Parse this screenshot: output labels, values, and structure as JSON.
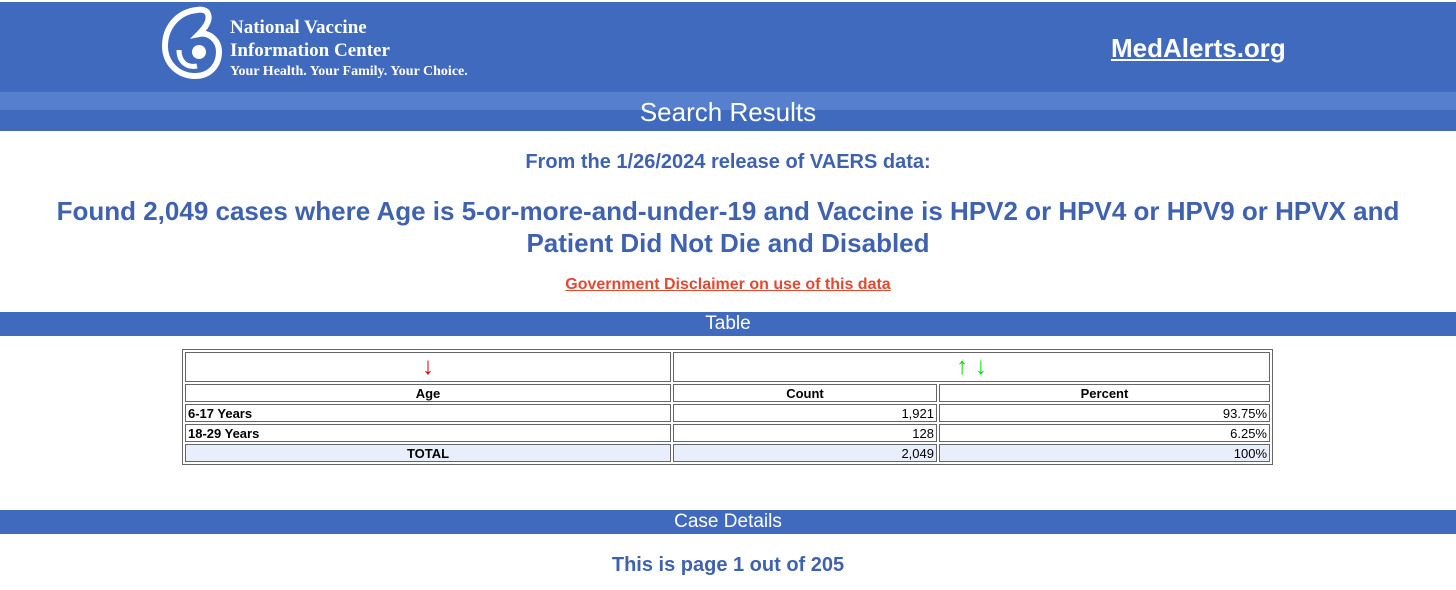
{
  "header": {
    "logo_line1": "National Vaccine",
    "logo_line2": "Information Center",
    "tagline": "Your Health. Your Family. Your Choice.",
    "site_link": "MedAlerts.org"
  },
  "results": {
    "title": "Search Results",
    "release": "From the 1/26/2024 release of VAERS data:",
    "found_line1": "Found 2,049 cases where Age is 5-or-more-and-under-19 and Vaccine is HPV2 or HPV4 or HPV9 or HPVX and",
    "found_line2": "Patient Did Not Die and Disabled",
    "disclaimer": "Government Disclaimer on use of this data"
  },
  "table_section": {
    "title": "Table",
    "arrows": {
      "age_sort": "↓",
      "count_sort_up": "↑",
      "count_sort_down": "↓"
    },
    "headers": [
      "Age",
      "Count",
      "Percent"
    ],
    "rows": [
      {
        "age": "6-17 Years",
        "count": "1,921",
        "percent": "93.75%"
      },
      {
        "age": "18-29 Years",
        "count": "128",
        "percent": "6.25%"
      }
    ],
    "total": {
      "label": "TOTAL",
      "count": "2,049",
      "percent": "100%"
    }
  },
  "case_details": {
    "title": "Case Details",
    "page_info": "This is page 1 out of 205"
  },
  "colors": {
    "header_blue": "#3f6abd",
    "text_blue": "#3f62b0",
    "disclaimer_red": "#e04a32",
    "sort_red": "#e00000",
    "sort_green": "#00dd00",
    "total_row_bg": "#e8eefb"
  }
}
